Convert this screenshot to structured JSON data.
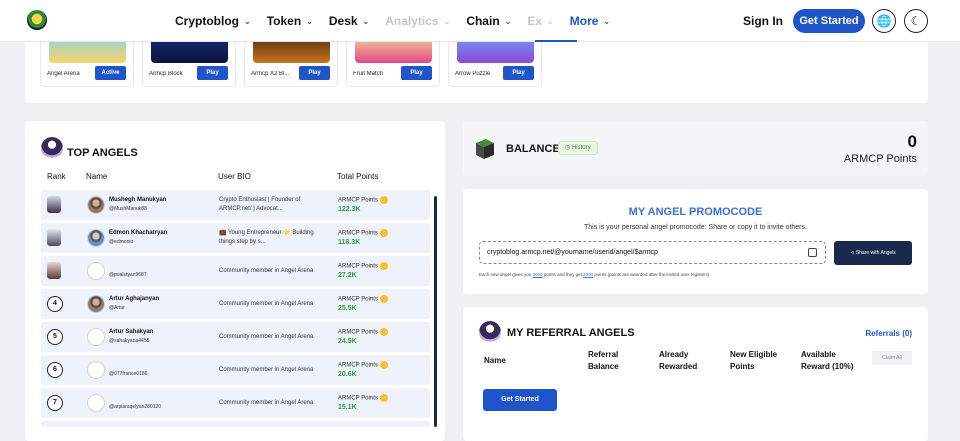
{
  "nav": {
    "items": [
      {
        "label": "Cryptoblog",
        "disabled": false
      },
      {
        "label": "Token",
        "disabled": false
      },
      {
        "label": "Desk",
        "disabled": false
      },
      {
        "label": "Analytics",
        "disabled": true
      },
      {
        "label": "Chain",
        "disabled": false
      },
      {
        "label": "Ex",
        "disabled": true
      },
      {
        "label": "More",
        "active": true
      }
    ],
    "sign_in": "Sign In",
    "get_started": "Get Started",
    "accent": "#1f55c9"
  },
  "games": [
    {
      "name": "Angel Arena",
      "button": "Active"
    },
    {
      "name": "Armcp Block",
      "button": "Play"
    },
    {
      "name": "Armcp X2 Bl...",
      "button": "Play"
    },
    {
      "name": "Fruit Match",
      "button": "Play"
    },
    {
      "name": "Arrow Puzzle",
      "button": "Play"
    }
  ],
  "top_angels": {
    "title": "TOP ANGELS",
    "headers": {
      "rank": "Rank",
      "name": "Name",
      "bio": "User BIO",
      "points": "Total Points"
    },
    "rows": [
      {
        "rank": "",
        "name": "Mushegh Manukyan",
        "handle": "@MushManuk88",
        "bio": "Crypto Enthusiast | Founder of ARMCP.net/ | Advocat...",
        "points_label": "ARMCP Points",
        "points": "122.3K"
      },
      {
        "rank": "",
        "name": "Edmon Khachatryan",
        "handle": "@edmonio",
        "bio": "💼 Young Entrepreneur 🌟 Building things step by s...",
        "points_label": "ARMCP Points",
        "points": "118.3K"
      },
      {
        "rank": "",
        "name": "",
        "handle": "@poalstyan9687",
        "bio": "Community member in Angel Arena",
        "points_label": "ARMCP Points",
        "points": "27.2K"
      },
      {
        "rank": "4",
        "name": "Artur Aghajanyan",
        "handle": "@Artur",
        "bio": "Community member in Angel Arena",
        "points_label": "ARMCP Points",
        "points": "25.5K"
      },
      {
        "rank": "5",
        "name": "Artur Sahakyan",
        "handle": "@sahakyana4455",
        "bio": "Community member in Angel Arena",
        "points_label": "ARMCP Points",
        "points": "24.5K"
      },
      {
        "rank": "6",
        "name": "",
        "handle": "@077france0186",
        "bio": "Community member in Angel Arena",
        "points_label": "ARMCP Points",
        "points": "20.6K"
      },
      {
        "rank": "7",
        "name": "",
        "handle": "@arpiaraqelyan280120",
        "bio": "Community member in Angel Arena",
        "points_label": "ARMCP Points",
        "points": "15.1K"
      }
    ]
  },
  "balance": {
    "title": "BALANCE",
    "history": "History",
    "value": "0",
    "unit": "ARMCP Points"
  },
  "promo": {
    "title": "MY ANGEL PROMOCODE",
    "desc": "This is your personal angel promocode: Share or copy it to invite others.",
    "code": "cryptoblog.armcp.net/@yourname/userid/angel/$armcp",
    "share": "Share with Angels",
    "note_a": "Each new angel gives you ",
    "note_b": "3000",
    "note_c": " points and they get ",
    "note_d": "2000",
    "note_e": " points (points are awarded after the invited user registers)"
  },
  "referral": {
    "title": "MY REFERRAL ANGELS",
    "count": "Referrals (0)",
    "headers": [
      "Name",
      "Referral Balance",
      "Already Rewarded",
      "New Eligible Points",
      "Available Reward (10%)"
    ],
    "claim": "Claim All",
    "get_started": "Get Started"
  }
}
